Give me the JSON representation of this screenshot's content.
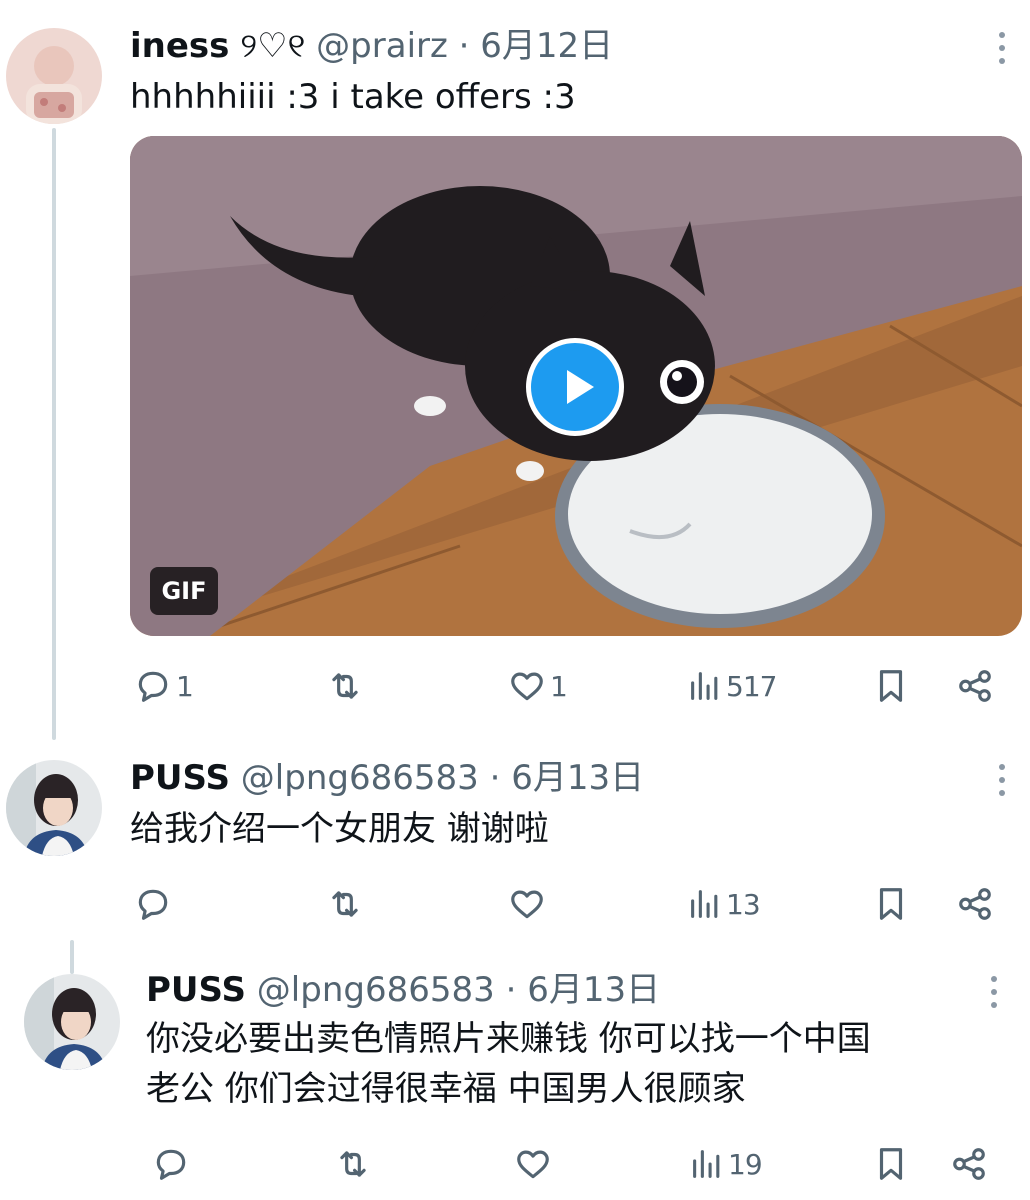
{
  "tweets": [
    {
      "display_name": "iness",
      "name_emoji": "୨♡୧",
      "handle": "@prairz",
      "separator": "·",
      "date": "6月12日",
      "text_lines": [
        "hhhhhiiii :3 i take offers :3"
      ],
      "media": {
        "type": "GIF",
        "badge": "GIF"
      },
      "stats": {
        "replies": "1",
        "retweets": "",
        "likes": "1",
        "views": "517"
      }
    },
    {
      "display_name": "PUSS",
      "handle": "@lpng686583",
      "separator": "·",
      "date": "6月13日",
      "text_lines": [
        "给我介绍一个女朋友   谢谢啦"
      ],
      "stats": {
        "replies": "",
        "retweets": "",
        "likes": "",
        "views": "13"
      }
    },
    {
      "display_name": "PUSS",
      "handle": "@lpng686583",
      "separator": "·",
      "date": "6月13日",
      "text_lines": [
        "你没必要出卖色情照片来赚钱  你可以找一个中国",
        "老公 你们会过得很幸福  中国男人很顾家"
      ],
      "stats": {
        "replies": "",
        "retweets": "",
        "likes": "",
        "views": "19"
      }
    }
  ],
  "colors": {
    "text": "#0f1419",
    "muted": "#536471",
    "accent_blue": "#1d9bf0",
    "thread_line": "#cfd9de"
  },
  "icons": [
    "reply-icon",
    "retweet-icon",
    "like-icon",
    "views-icon",
    "bookmark-icon",
    "share-icon",
    "more-icon",
    "play-icon"
  ]
}
